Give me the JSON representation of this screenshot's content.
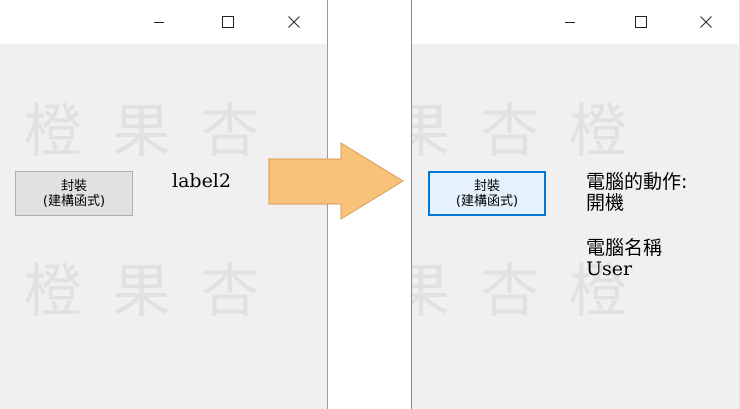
{
  "left_window": {
    "button": {
      "line1": "封裝",
      "line2": "(建構函式)"
    },
    "label": "label2"
  },
  "right_window": {
    "button": {
      "line1": "封裝",
      "line2": "(建構函式)"
    },
    "action_title": "電腦的動作:",
    "action_value": "開機",
    "name_title": "電腦名稱",
    "name_value": "User"
  },
  "watermark": {
    "chars": [
      "橙",
      "果",
      "杏"
    ]
  },
  "colors": {
    "arrow_fill": "#f9c27a",
    "arrow_stroke": "#d9a055",
    "focus": "#0078d7"
  }
}
